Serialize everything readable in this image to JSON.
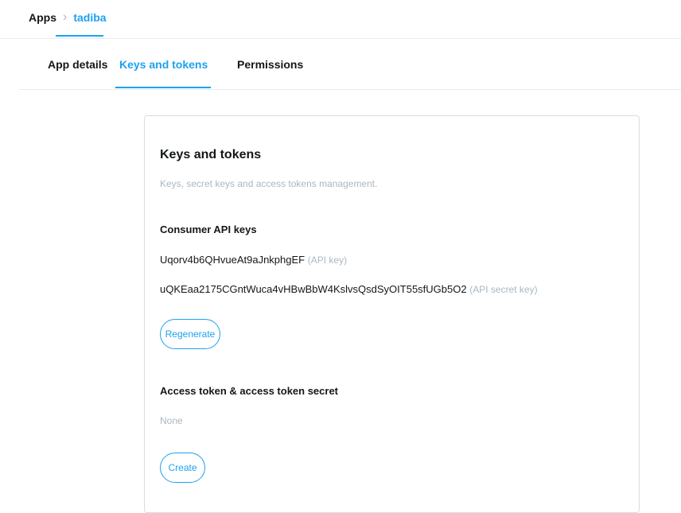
{
  "breadcrumb": {
    "root": "Apps",
    "separator": "›",
    "current": "tadiba"
  },
  "tabs": [
    {
      "label": "App details",
      "active": false
    },
    {
      "label": "Keys and tokens",
      "active": true
    },
    {
      "label": "Permissions",
      "active": false
    }
  ],
  "card": {
    "title": "Keys and tokens",
    "subtitle": "Keys, secret keys and access tokens management.",
    "consumer": {
      "title": "Consumer API keys",
      "api_key": {
        "value": "Uqorv4b6QHvueAt9aJnkphgEF",
        "label": "(API key)"
      },
      "api_secret_key": {
        "value": "uQKEaa2175CGntWuca4vHBwBbW4KslvsQsdSyOIT55sfUGb5O2",
        "label": "(API secret key)"
      },
      "regenerate_label": "Regenerate"
    },
    "access": {
      "title": "Access token & access token secret",
      "status": "None",
      "create_label": "Create"
    }
  },
  "colors": {
    "accent": "#1da1f2",
    "text": "#14171a",
    "muted": "#aab8c2",
    "border": "#d6dde3",
    "divider": "#e6ecf0"
  }
}
